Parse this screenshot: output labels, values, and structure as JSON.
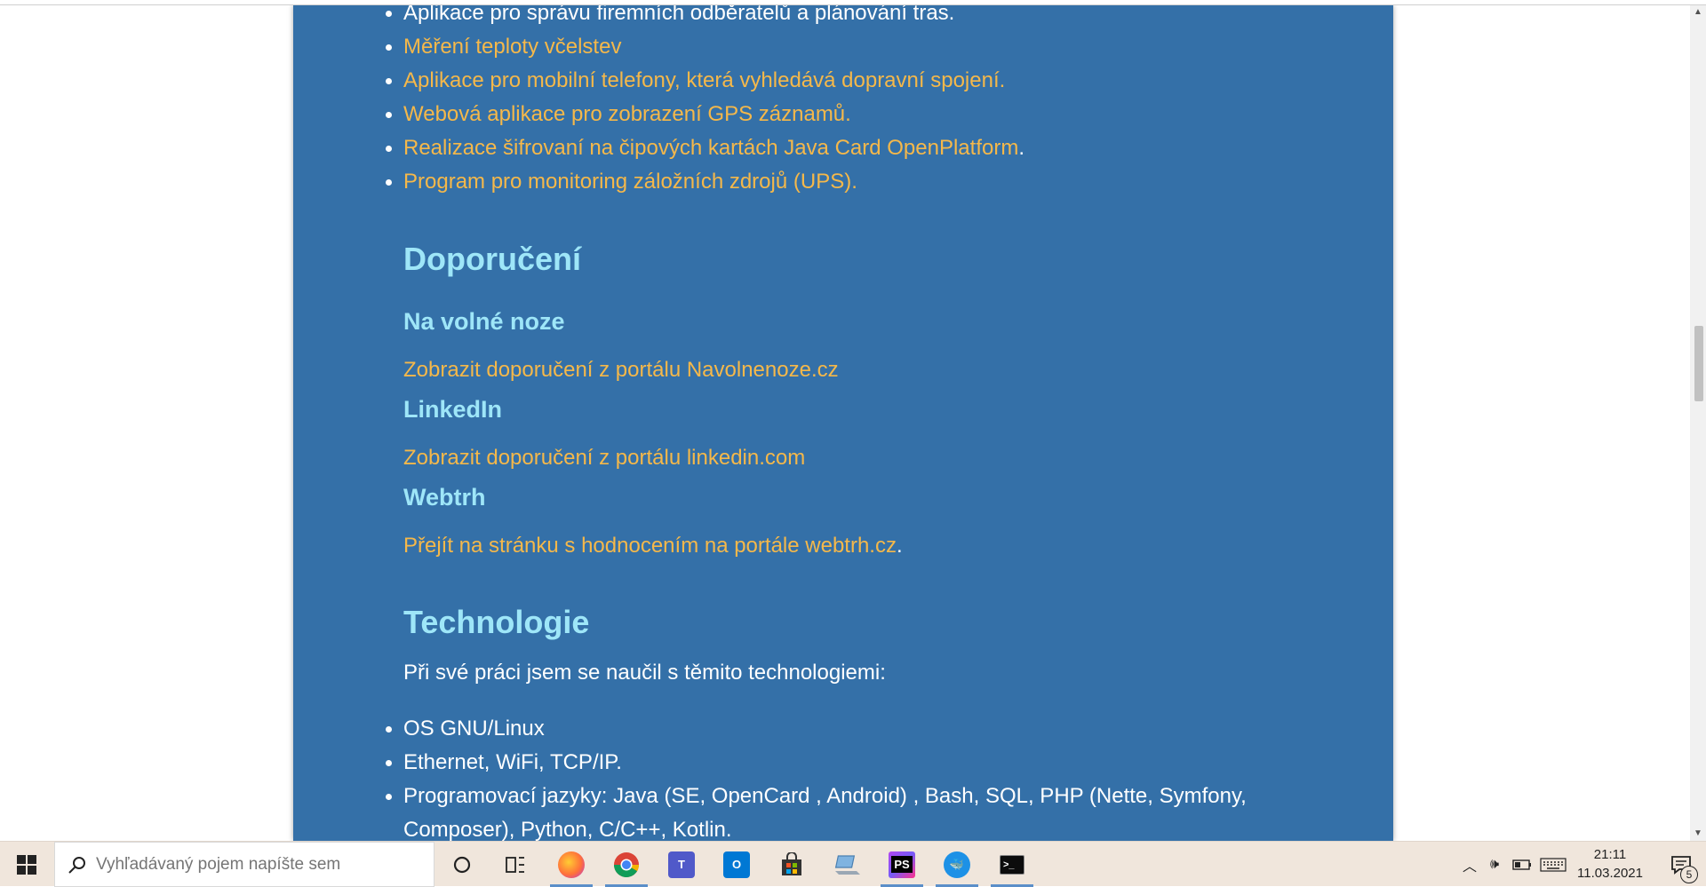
{
  "projects_list": [
    {
      "text": "Aplikace pro správu firemních odběratelů a plánování tras.",
      "link": false
    },
    {
      "text": "Měření teploty včelstev",
      "link": true
    },
    {
      "text": "Aplikace pro mobilní telefony, která vyhledává dopravní spojení.",
      "link": true
    },
    {
      "text": "Webová aplikace pro zobrazení GPS záznamů.",
      "link": true
    },
    {
      "text": "Realizace šifrovaní na čipových kartách Java Card OpenPlatform",
      "link": true,
      "suffix": "."
    },
    {
      "text": "Program pro monitoring záložních zdrojů (UPS).",
      "link": true
    }
  ],
  "recommendations": {
    "heading": "Doporučení",
    "navolnenoze": {
      "heading": "Na volné noze",
      "link": "Zobrazit doporučení z portálu Navolnenoze.cz"
    },
    "linkedin": {
      "heading": "LinkedIn",
      "link": "Zobrazit doporučení z portálu linkedin.com"
    },
    "webtrh": {
      "heading": "Webtrh",
      "link": "Přejít na stránku s hodnocením na portále webtrh.cz",
      "suffix": "."
    }
  },
  "technologies": {
    "heading": "Technologie",
    "intro": "Při své práci jsem se naučil s těmito technologiemi:",
    "items": [
      "OS GNU/Linux",
      "Ethernet, WiFi, TCP/IP.",
      "Programovací jazyky: Java (SE, OpenCard , Android) , Bash, SQL, PHP (Nette, Symfony,",
      "Composer), Python, C/C++, Kotlin."
    ]
  },
  "taskbar": {
    "search_placeholder": "Vyhľadávaný pojem napíšte sem",
    "time": "21:11",
    "date": "11.03.2021",
    "notification_count": "5",
    "apps": [
      "cortana-icon",
      "task-view-icon",
      "firefox-icon",
      "chrome-icon",
      "teams-icon",
      "outlook-icon",
      "store-icon",
      "laptop-app-icon",
      "phpstorm-icon",
      "docker-icon",
      "terminal-icon"
    ]
  },
  "colors": {
    "card_bg": "#3470a8",
    "heading": "#9ee6f8",
    "link": "#f5b84a",
    "text": "#ffffff"
  }
}
